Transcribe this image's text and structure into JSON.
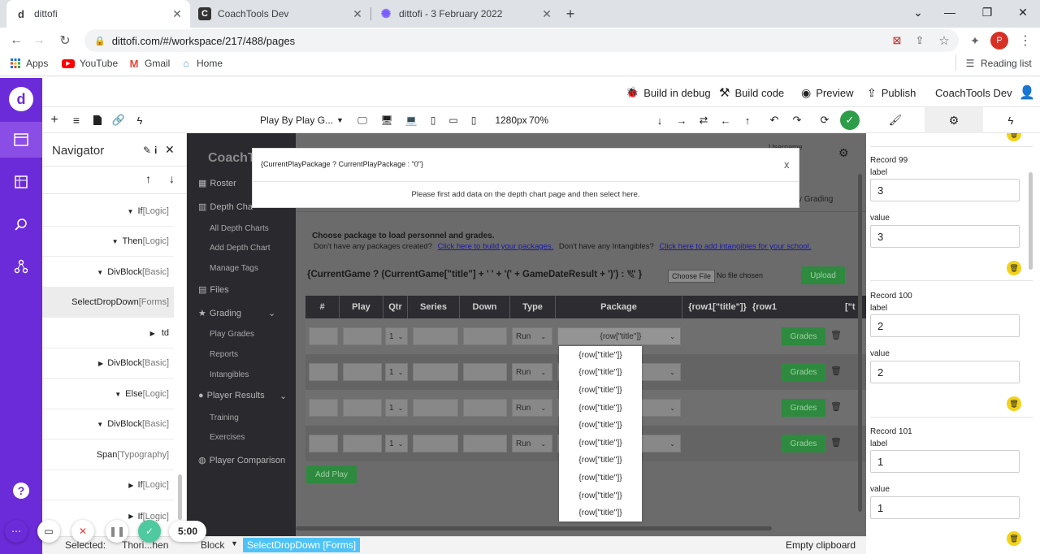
{
  "browser": {
    "tabs": [
      {
        "title": "dittofi",
        "favicon": "d"
      },
      {
        "title": "CoachTools Dev",
        "favicon": "C"
      },
      {
        "title": "dittofi - 3 February 2022",
        "favicon": "✺"
      }
    ],
    "new_tab": "+",
    "url": "dittofi.com/#/workspace/217/488/pages",
    "bookmarks": [
      {
        "label": "Apps"
      },
      {
        "label": "YouTube"
      },
      {
        "label": "Gmail"
      },
      {
        "label": "Home"
      }
    ],
    "reading_list": "Reading list",
    "profile_initial": "P"
  },
  "topbar": {
    "build_debug": "Build in debug",
    "build_code": "Build code",
    "preview": "Preview",
    "publish": "Publish",
    "project": "CoachTools Dev"
  },
  "toolbar": {
    "page_select": "Play By Play G...",
    "resolution": "1280px",
    "zoom": "70%"
  },
  "navigator": {
    "title": "Navigator",
    "rows": [
      {
        "name": "If",
        "tag": "[Logic]"
      },
      {
        "name": "Then",
        "tag": "[Logic]"
      },
      {
        "name": "DivBlock",
        "tag": "[Basic]"
      },
      {
        "name": "SelectDropDown",
        "tag": "[Forms]"
      },
      {
        "name": "td",
        "tag": ""
      },
      {
        "name": "DivBlock",
        "tag": "[Basic]"
      },
      {
        "name": "Else",
        "tag": "[Logic]"
      },
      {
        "name": "DivBlock",
        "tag": "[Basic]"
      },
      {
        "name": "Span",
        "tag": "[Typography]"
      },
      {
        "name": "If",
        "tag": "[Logic]"
      },
      {
        "name": "If",
        "tag": "[Logic]"
      }
    ]
  },
  "canvas": {
    "logo": "CoachT",
    "username": "Username",
    "username2": "me",
    "sidebar": [
      {
        "label": "Roster",
        "kind": "head"
      },
      {
        "label": "Depth Cha",
        "kind": "head"
      },
      {
        "label": "All Depth Charts",
        "kind": "link"
      },
      {
        "label": "Add Depth Chart",
        "kind": "link"
      },
      {
        "label": "Manage Tags",
        "kind": "link"
      },
      {
        "label": "Files",
        "kind": "head"
      },
      {
        "label": "Grading",
        "kind": "head"
      },
      {
        "label": "Play Grades",
        "kind": "link"
      },
      {
        "label": "Reports",
        "kind": "link"
      },
      {
        "label": "Intangibles",
        "kind": "link"
      },
      {
        "label": "Player Results",
        "kind": "head"
      },
      {
        "label": "Training",
        "kind": "link"
      },
      {
        "label": "Exercises",
        "kind": "link"
      },
      {
        "label": "Player Comparison",
        "kind": "head"
      }
    ],
    "grading_crumb": "y Grading",
    "choose_package": "Choose package to load personnel and grades.",
    "no_packages": "Don't have any packages created?",
    "build_packages_link": "Click here to build your packages.",
    "no_intangibles": "Don't have any Intangibles?",
    "intangibles_link": "Click here to add intangibles for your school.",
    "current_game_expr": "{CurrentGame ? (CurrentGame[\"title\"] + ' ' + '(' + GameDateResult + ')') : \"\" }",
    "choose_file": "Choose File",
    "no_file": "No file chosen",
    "upload": "Upload",
    "table_headers": [
      "#",
      "Play",
      "Qtr",
      "Series",
      "Down",
      "Type",
      "Package",
      "{row1[\"title\"]}",
      "{row1",
      "[\"t"
    ],
    "rows": [
      {
        "qtr": "1",
        "type": "Run",
        "package": "{row[\"title\"]}",
        "grades": "Grades"
      },
      {
        "qtr": "1",
        "type": "Run",
        "package": "",
        "grades": "Grades"
      },
      {
        "qtr": "1",
        "type": "Run",
        "package": "",
        "grades": "Grades"
      },
      {
        "qtr": "1",
        "type": "Run",
        "package": "",
        "grades": "Grades"
      }
    ],
    "add_play": "Add Play",
    "dropdown_items": [
      "{row[\"title\"]}",
      "{row[\"title\"]}",
      "{row[\"title\"]}",
      "{row[\"title\"]}",
      "{row[\"title\"]}",
      "{row[\"title\"]}",
      "{row[\"title\"]}",
      "{row[\"title\"]}",
      "{row[\"title\"]}",
      "{row[\"title\"]}"
    ]
  },
  "modal": {
    "title": "{CurrentPlayPackage ? CurrentPlayPackage : \"0\"}",
    "message": "Please first add data on the depth chart page and then select here.",
    "close": "x"
  },
  "props": {
    "records": [
      {
        "title": "Record 99",
        "label_caption": "label",
        "label_value": "3",
        "value_caption": "value",
        "value_value": "3"
      },
      {
        "title": "Record 100",
        "label_caption": "label",
        "label_value": "2",
        "value_caption": "value",
        "value_value": "2"
      },
      {
        "title": "Record 101",
        "label_caption": "label",
        "label_value": "1",
        "value_caption": "value",
        "value_value": "1"
      }
    ]
  },
  "bottombar": {
    "selected": "Selected:",
    "crumb1": "Thori...hen",
    "crumb2": "Block",
    "current": "SelectDropDown [Forms]",
    "clipboard": "Empty clipboard"
  },
  "recorder": {
    "time": "5:00"
  },
  "colors": {
    "brand_purple": "#6c2bd9",
    "success_green": "#2e8a3e",
    "highlight_cyan": "#4fc3f7",
    "trash_yellow": "#f2d21b"
  }
}
